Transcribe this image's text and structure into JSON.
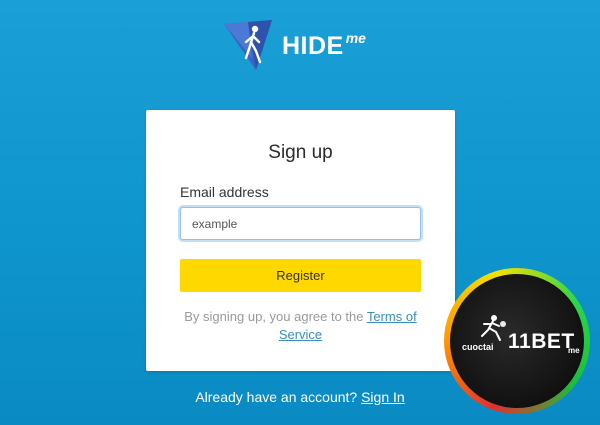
{
  "header": {
    "logo_text": "HIDE",
    "logo_sup": "me"
  },
  "card": {
    "title": "Sign up",
    "email_label": "Email address",
    "email_value": "example",
    "register_label": "Register",
    "terms_prefix": "By signing up, you agree to the ",
    "terms_link": "Terms of Service"
  },
  "footer": {
    "prompt": "Already have an account? ",
    "signin_link": "Sign In"
  },
  "badge": {
    "left_text": "cuoctai",
    "brand_text": "11BET",
    "right_text": "me"
  },
  "colors": {
    "background": "#1aa0d6",
    "card": "#ffffff",
    "button": "#ffd800",
    "link": "#3a8fb7"
  },
  "icons": {
    "logo": "hideme-triangle-walker-icon",
    "badge_figure": "runner-figure-icon"
  }
}
